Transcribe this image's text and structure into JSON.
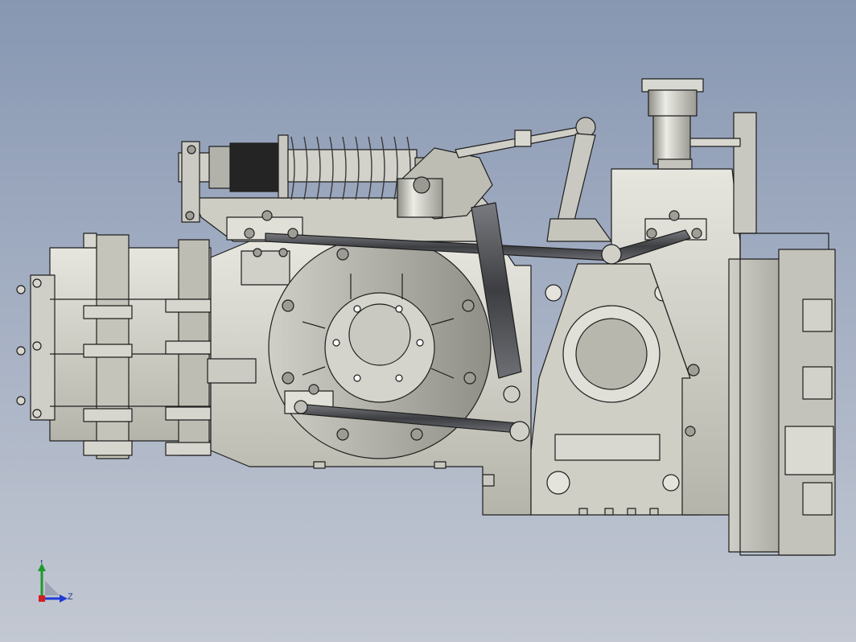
{
  "viewport": {
    "background_top": "#8797b2",
    "background_bottom": "#c3c8d2"
  },
  "model": {
    "subject": "suspension-gearbox-assembly",
    "part_fill": "#dadad3",
    "part_shade": "#a9a99f",
    "edge_color": "#1e1e1e",
    "spring_color": "#c9c9c2",
    "rod_color": "#55565a"
  },
  "triad": {
    "y_label": "Y",
    "z_label": "Z",
    "y_color": "#1e9a2a",
    "z_color": "#1f3bd6",
    "x_color": "#d21f1f"
  }
}
